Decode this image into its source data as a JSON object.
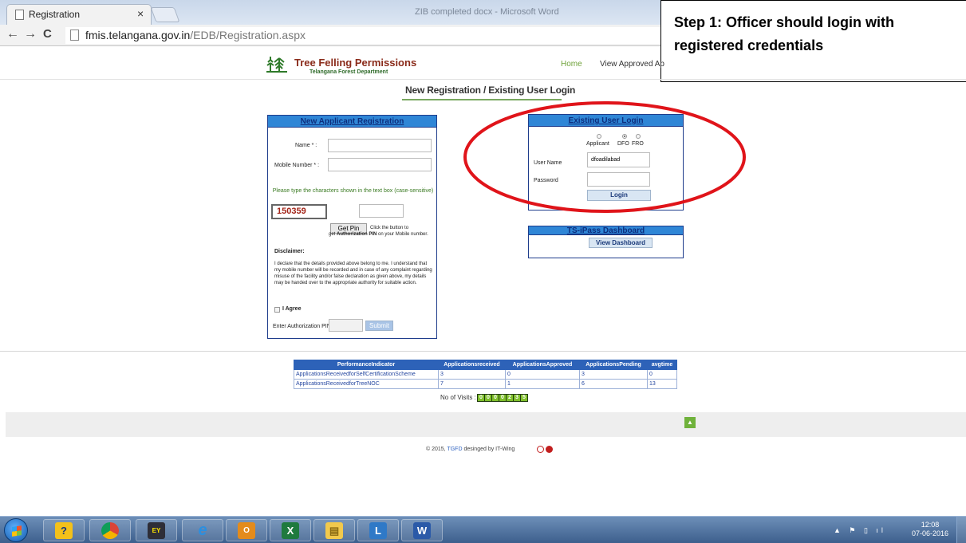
{
  "browser": {
    "tab_title": "Registration",
    "tab_close": "×",
    "background_window_title": "ZIB completed docx - Microsoft Word",
    "url_host": "fmis.telangana.gov.in",
    "url_path": "/EDB/Registration.aspx",
    "back": "←",
    "forward": "→",
    "reload": "C"
  },
  "callout": {
    "text": "Step 1: Officer should login with\nregistered credentials"
  },
  "site": {
    "title": "Tree Felling Permissions",
    "subtitle": "Telangana Forest Department",
    "nav_home": "Home",
    "nav_approved": "View Approved Ap",
    "heading": "New Registration / Existing User Login"
  },
  "new_applicant": {
    "header": "New Applicant Registration",
    "name_label": "Name * :",
    "mobile_label": "Mobile Number * :",
    "captcha_instruction": "Please type the characters shown in the text box (case-sensitive)",
    "captcha_code": "150359",
    "get_pin_label": "Get Pin",
    "pin_help_1": "Click the button to",
    "pin_help_2": "get",
    "pin_help_bold": "Authorization PIN",
    "pin_help_3": "on your Mobile number.",
    "disclaimer_title": "Disclaimer:",
    "disclaimer_text": "I declare that the details provided above belong to me. I understand that my mobile number will be recorded and in case of any complaint regarding misuse of the facility and/or false declaration as given above, my details may be handed over to the appropriate authority for suitable action.",
    "agree_label": "I Agree",
    "auth_pin_label": "Enter Authorization PIN:",
    "submit_label": "Submit"
  },
  "existing_user": {
    "header": "Existing User Login",
    "role_applicant": "Applicant",
    "role_dfo": "DFO",
    "role_fro": "FRO",
    "selected_role": "DFO",
    "username_label": "User Name",
    "username_value": "dfoadilabad",
    "password_label": "Password",
    "login_label": "Login"
  },
  "tsipass": {
    "header": "TS-iPass Dashboard",
    "button_label": "View Dashboard"
  },
  "performance": {
    "headers": [
      "PerformanceIndicator",
      "Applicationsreceived",
      "ApplicationsApproved",
      "ApplicationsPending",
      "avgtime"
    ],
    "rows": [
      [
        "ApplicationsReceivedforSelfCertificationScheme",
        "3",
        "0",
        "3",
        "0"
      ],
      [
        "ApplicationsReceivedforTreeNOC",
        "7",
        "1",
        "6",
        "13"
      ]
    ],
    "visits_label": "No of Visits :",
    "visits_digits": [
      "0",
      "0",
      "0",
      "0",
      "2",
      "3",
      "5"
    ]
  },
  "footer": {
    "copyright_prefix": "© 2015,",
    "copyright_link": "TGFD",
    "copyright_suffix": "desinged by IT-Wing"
  },
  "taskbar": {
    "items": [
      "help-icon",
      "chrome-icon",
      "ey-discover-icon",
      "ie-icon",
      "outlook-icon",
      "excel-icon",
      "explorer-icon",
      "lync-icon",
      "word-icon"
    ],
    "time": "12:08",
    "date": "07-06-2016"
  },
  "colors": {
    "panel_header": "#2f86d6",
    "table_header": "#2d62b8",
    "highlight_ellipse": "#e0141a",
    "site_title": "#8a2b1a"
  }
}
